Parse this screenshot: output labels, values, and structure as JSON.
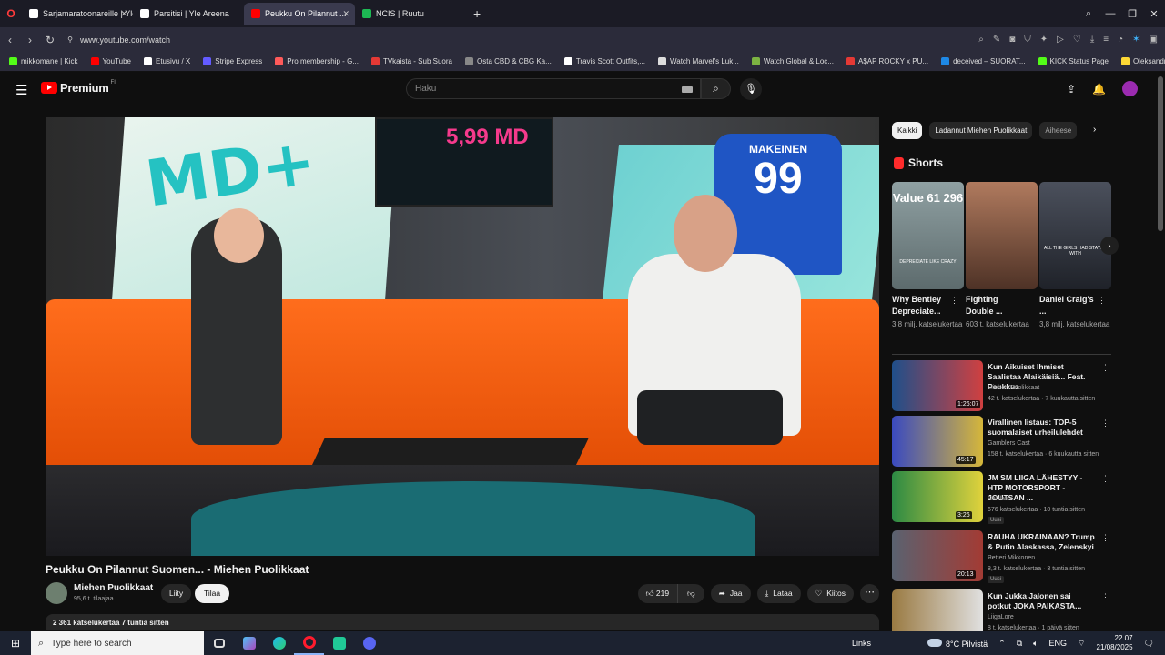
{
  "browser": {
    "tabs": [
      {
        "label": "Sarjamaratoonareille | Yle...",
        "color": "#ffffff"
      },
      {
        "label": "Parsitisi | Yle Areena",
        "color": "#ffffff"
      },
      {
        "label": "Peukku On Pilannut ...",
        "color": "#ff0000",
        "active": true
      },
      {
        "label": "NCIS | Ruutu",
        "color": "#1db954"
      }
    ],
    "new_tab": "+",
    "url": "www.youtube.com/watch",
    "bookmarks": [
      {
        "label": "mikkomane | Kick",
        "color": "#53fc18"
      },
      {
        "label": "YouTube",
        "color": "#ff0000"
      },
      {
        "label": "Etusivu / X",
        "color": "#ffffff"
      },
      {
        "label": "Stripe Express",
        "color": "#635bff"
      },
      {
        "label": "Pro membership - G...",
        "color": "#ff5a5a"
      },
      {
        "label": "TVkaista - Sub Suora",
        "color": "#e53935"
      },
      {
        "label": "Osta CBD & CBG Ka...",
        "color": "#888888"
      },
      {
        "label": "Travis Scott Outfits,...",
        "color": "#ffffff"
      },
      {
        "label": "Watch Marvel's Luk...",
        "color": "#dddddd"
      },
      {
        "label": "Watch Global & Loc...",
        "color": "#7cb342"
      },
      {
        "label": "A$AP ROCKY x PU...",
        "color": "#e53935"
      },
      {
        "label": "deceived – SUORAT...",
        "color": "#1e88e5"
      },
      {
        "label": "KICK Status Page",
        "color": "#53fc18"
      },
      {
        "label": "Oleksandr Usyk vs D...",
        "color": "#fdd835"
      }
    ]
  },
  "youtube": {
    "logo_word": "Premium",
    "logo_region": "FI",
    "search_placeholder": "Haku",
    "video": {
      "title": "Peukku On Pilannut Suomen... - Miehen Puolikkaat",
      "overlay_art": "MD+",
      "tv_text": "5,99 MD",
      "jersey_name": "MAKEINEN",
      "jersey_number": "99",
      "channel": "Miehen Puolikkaat",
      "subscribers": "95,6 t. tilaajaa",
      "join_label": "Liity",
      "subscribe_label": "Tilaa",
      "likes": "219",
      "share_label": "Jaa",
      "download_label": "Lataa",
      "thanks_label": "Kiitos",
      "views_line": "2 361 katselukertaa  7 tuntia sitten"
    },
    "chips": [
      "Kaikki",
      "Ladannut Miehen Puolikkaat",
      "Aiheese"
    ],
    "shorts_heading": "Shorts",
    "shorts": [
      {
        "title": "Why Bentley Depreciate...",
        "views": "3,8 milj. katselukertaa",
        "overlay": "Value 61 296",
        "sub": "DEPRECIATE LIKE CRAZY",
        "color": "#7b8c8e"
      },
      {
        "title": "Fighting Double ...",
        "views": "603 t. katselukertaa",
        "overlay": "",
        "sub": "",
        "color": "#8a5a44"
      },
      {
        "title": "Daniel Craig's ...",
        "views": "3,8 milj. katselukertaa",
        "overlay": "",
        "sub": "ALL THE GIRLS HAD STAYED WITH",
        "color": "#3b3f4a"
      }
    ],
    "recommended": [
      {
        "title": "Kun Aikuiset Ihmiset Saalistaa Alaikäisiä... Feat. Peukkuz",
        "channel": "Miehen Puolikkaat",
        "meta": "42 t. katselukertaa · 7 kuukautta sitten",
        "duration": "1:26:07",
        "badge": "",
        "color": "#2e6fb0"
      },
      {
        "title": "Virallinen listaus: TOP-5 suomalaiset urheilulehdet",
        "channel": "Gamblers Cast",
        "meta": "158 t. katselukertaa · 6 kuukautta sitten",
        "duration": "45:17",
        "badge": "",
        "color": "#3f4bb8"
      },
      {
        "title": "JM SM LIIGA LÄHESTYY - HTP MOTORSPORT - JOUTSAN ...",
        "channel": "Rallilatsi",
        "meta": "676 katselukertaa · 10 tuntia sitten",
        "duration": "3:26",
        "badge": "Uusi",
        "color": "#2f8a4a"
      },
      {
        "title": "RAUHA UKRAINAAN? Trump & Putin Alaskassa, Zelenskyi ...",
        "channel": "Petteri Mikkonen",
        "meta": "8,3 t. katselukertaa · 3 tuntia sitten",
        "duration": "20:13",
        "badge": "Uusi",
        "color": "#555c66"
      },
      {
        "title": "Kun Jukka Jalonen sai potkut JOKA PAIKASTA...",
        "channel": "LiigaLore",
        "meta": "8 t. katselukertaa · 1 päivä sitten",
        "duration": "",
        "badge": "",
        "color": "#8a6a3a"
      }
    ]
  },
  "taskbar": {
    "search_placeholder": "Type here to search",
    "links_label": "Links",
    "weather": "8°C  Pilvistä",
    "lang": "ENG",
    "time": "22.07",
    "date": "21/08/2025"
  }
}
